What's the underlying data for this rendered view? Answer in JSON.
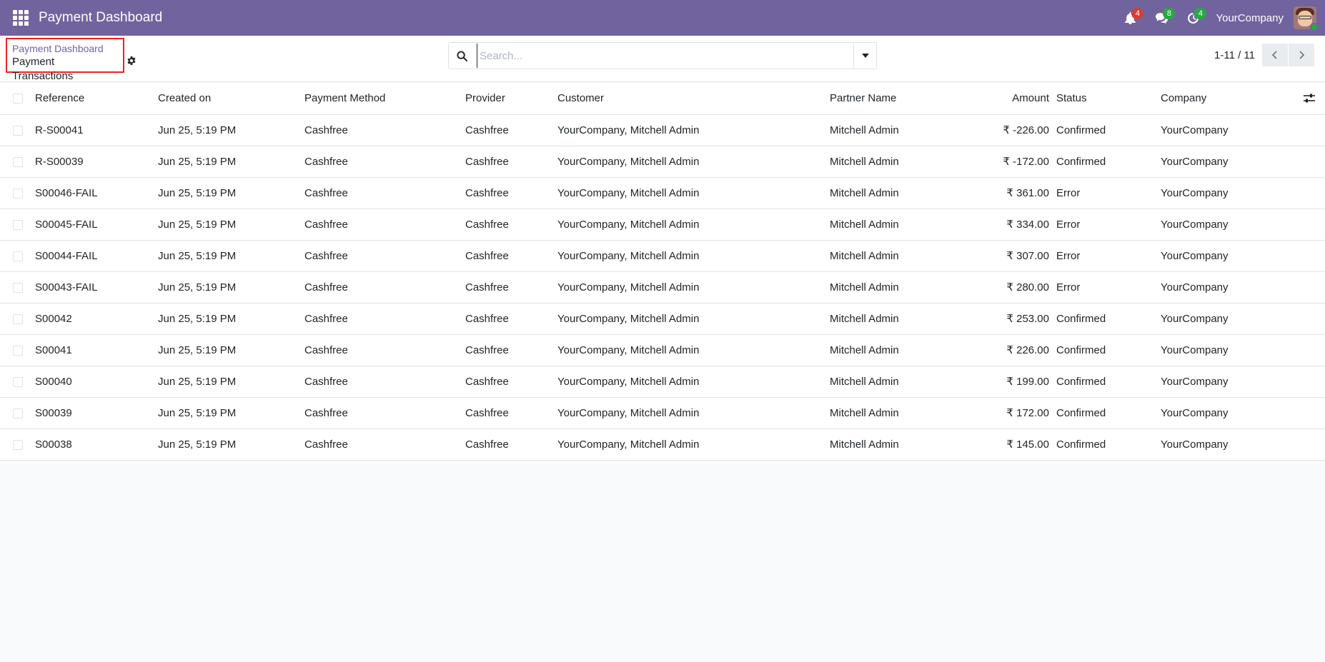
{
  "navbar": {
    "app_title": "Payment Dashboard",
    "notifications": {
      "activity_count": "4",
      "messages_count": "8",
      "timer_count": "4"
    },
    "company": "YourCompany",
    "colors": {
      "navbar": "#71639e",
      "badge_red": "#d23f3a",
      "badge_green": "#28a745"
    }
  },
  "breadcrumb": {
    "parent": "Payment Dashboard",
    "current": "Payment Transactions"
  },
  "search": {
    "placeholder": "Search...",
    "value": ""
  },
  "pager": {
    "value": "1-11 / 11"
  },
  "table": {
    "columns": {
      "reference": "Reference",
      "created_on": "Created on",
      "payment_method": "Payment Method",
      "provider": "Provider",
      "customer": "Customer",
      "partner_name": "Partner Name",
      "amount": "Amount",
      "status": "Status",
      "company": "Company"
    },
    "rows": [
      {
        "reference": "R-S00041",
        "created_on": "Jun 25, 5:19 PM",
        "payment_method": "Cashfree",
        "provider": "Cashfree",
        "customer": "YourCompany, Mitchell Admin",
        "partner_name": "Mitchell Admin",
        "amount": "₹ -226.00",
        "status": "Confirmed",
        "company": "YourCompany"
      },
      {
        "reference": "R-S00039",
        "created_on": "Jun 25, 5:19 PM",
        "payment_method": "Cashfree",
        "provider": "Cashfree",
        "customer": "YourCompany, Mitchell Admin",
        "partner_name": "Mitchell Admin",
        "amount": "₹ -172.00",
        "status": "Confirmed",
        "company": "YourCompany"
      },
      {
        "reference": "S00046-FAIL",
        "created_on": "Jun 25, 5:19 PM",
        "payment_method": "Cashfree",
        "provider": "Cashfree",
        "customer": "YourCompany, Mitchell Admin",
        "partner_name": "Mitchell Admin",
        "amount": "₹ 361.00",
        "status": "Error",
        "company": "YourCompany"
      },
      {
        "reference": "S00045-FAIL",
        "created_on": "Jun 25, 5:19 PM",
        "payment_method": "Cashfree",
        "provider": "Cashfree",
        "customer": "YourCompany, Mitchell Admin",
        "partner_name": "Mitchell Admin",
        "amount": "₹ 334.00",
        "status": "Error",
        "company": "YourCompany"
      },
      {
        "reference": "S00044-FAIL",
        "created_on": "Jun 25, 5:19 PM",
        "payment_method": "Cashfree",
        "provider": "Cashfree",
        "customer": "YourCompany, Mitchell Admin",
        "partner_name": "Mitchell Admin",
        "amount": "₹ 307.00",
        "status": "Error",
        "company": "YourCompany"
      },
      {
        "reference": "S00043-FAIL",
        "created_on": "Jun 25, 5:19 PM",
        "payment_method": "Cashfree",
        "provider": "Cashfree",
        "customer": "YourCompany, Mitchell Admin",
        "partner_name": "Mitchell Admin",
        "amount": "₹ 280.00",
        "status": "Error",
        "company": "YourCompany"
      },
      {
        "reference": "S00042",
        "created_on": "Jun 25, 5:19 PM",
        "payment_method": "Cashfree",
        "provider": "Cashfree",
        "customer": "YourCompany, Mitchell Admin",
        "partner_name": "Mitchell Admin",
        "amount": "₹ 253.00",
        "status": "Confirmed",
        "company": "YourCompany"
      },
      {
        "reference": "S00041",
        "created_on": "Jun 25, 5:19 PM",
        "payment_method": "Cashfree",
        "provider": "Cashfree",
        "customer": "YourCompany, Mitchell Admin",
        "partner_name": "Mitchell Admin",
        "amount": "₹ 226.00",
        "status": "Confirmed",
        "company": "YourCompany"
      },
      {
        "reference": "S00040",
        "created_on": "Jun 25, 5:19 PM",
        "payment_method": "Cashfree",
        "provider": "Cashfree",
        "customer": "YourCompany, Mitchell Admin",
        "partner_name": "Mitchell Admin",
        "amount": "₹ 199.00",
        "status": "Confirmed",
        "company": "YourCompany"
      },
      {
        "reference": "S00039",
        "created_on": "Jun 25, 5:19 PM",
        "payment_method": "Cashfree",
        "provider": "Cashfree",
        "customer": "YourCompany, Mitchell Admin",
        "partner_name": "Mitchell Admin",
        "amount": "₹ 172.00",
        "status": "Confirmed",
        "company": "YourCompany"
      },
      {
        "reference": "S00038",
        "created_on": "Jun 25, 5:19 PM",
        "payment_method": "Cashfree",
        "provider": "Cashfree",
        "customer": "YourCompany, Mitchell Admin",
        "partner_name": "Mitchell Admin",
        "amount": "₹ 145.00",
        "status": "Confirmed",
        "company": "YourCompany"
      }
    ]
  }
}
